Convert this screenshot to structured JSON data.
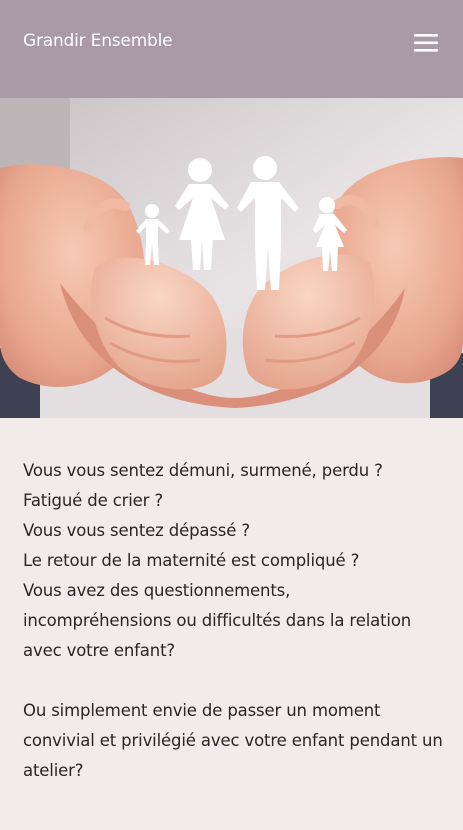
{
  "header": {
    "site_title": "Grandir Ensemble",
    "menu_icon": "hamburger-menu-icon",
    "background_color": "#a99aa5"
  },
  "hero": {
    "image_subject": "hands-holding-paper-family-cutout"
  },
  "intro": {
    "paragraph1_lines": [
      "Vous vous sentez démuni, surmené, perdu ?",
      "Fatigué de crier ?",
      "Vous vous sentez dépassé ?",
      "Le retour de la maternité est compliqué ?",
      "Vous avez des questionnements,",
      "incompréhensions ou difficultés dans la relation",
      "avec votre enfant?"
    ],
    "paragraph2_lines": [
      "Ou simplement envie de passer un moment",
      "convivial et privilégié avec votre enfant pendant un",
      "atelier?"
    ]
  },
  "colors": {
    "page_background": "#f1ece9",
    "text": "#2a2526"
  }
}
